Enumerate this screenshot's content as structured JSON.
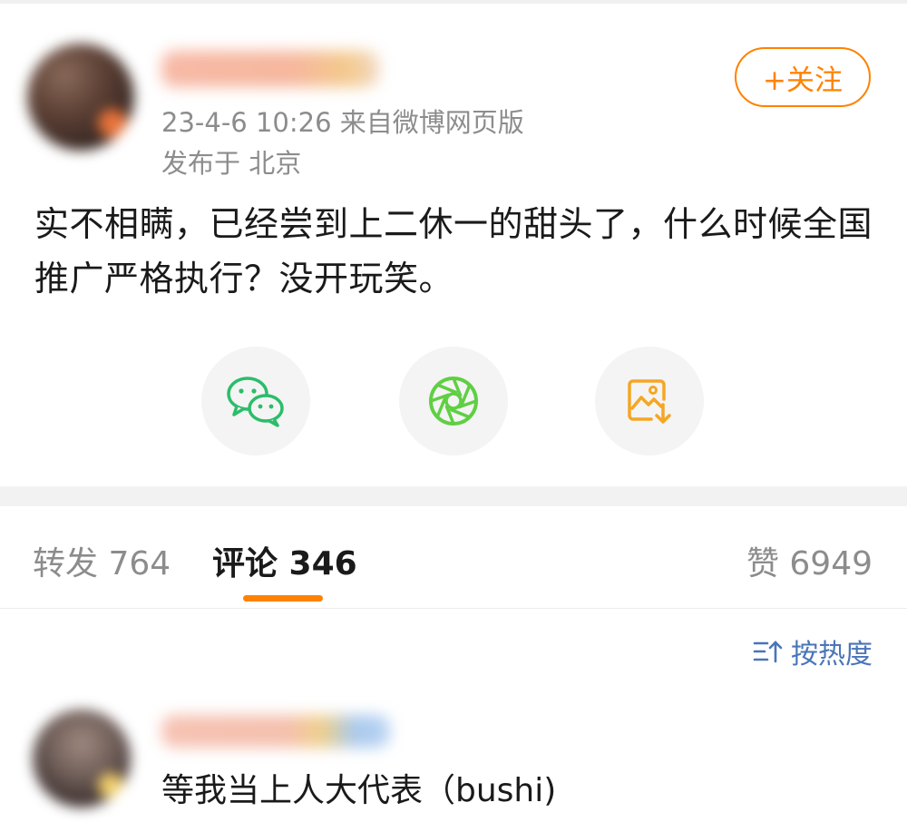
{
  "post": {
    "meta_time_source": "23-4-6 10:26  来自微博网页版",
    "location": "发布于 北京",
    "follow_button": "+关注",
    "text": "实不相瞒，已经尝到上二休一的甜头了，什么时候全国推广严格执行？没开玩笑。"
  },
  "share": {
    "icons": [
      "wechat-icon",
      "moments-icon",
      "save-image-icon"
    ],
    "colors": {
      "wechat": "#2bbd6a",
      "moments": "#5fcf43",
      "save": "#f5a623"
    }
  },
  "tabs": {
    "repost": "转发 764",
    "comments": "评论 346",
    "likes": "赞 6949"
  },
  "sort": {
    "label": "按热度",
    "icon": "sort-icon"
  },
  "comments": [
    {
      "text": "等我当上人大代表（bushi)"
    }
  ],
  "colors": {
    "accent": "#ff8200",
    "sort_blue": "#4a75b8",
    "meta_gray": "#8c8c8c"
  }
}
